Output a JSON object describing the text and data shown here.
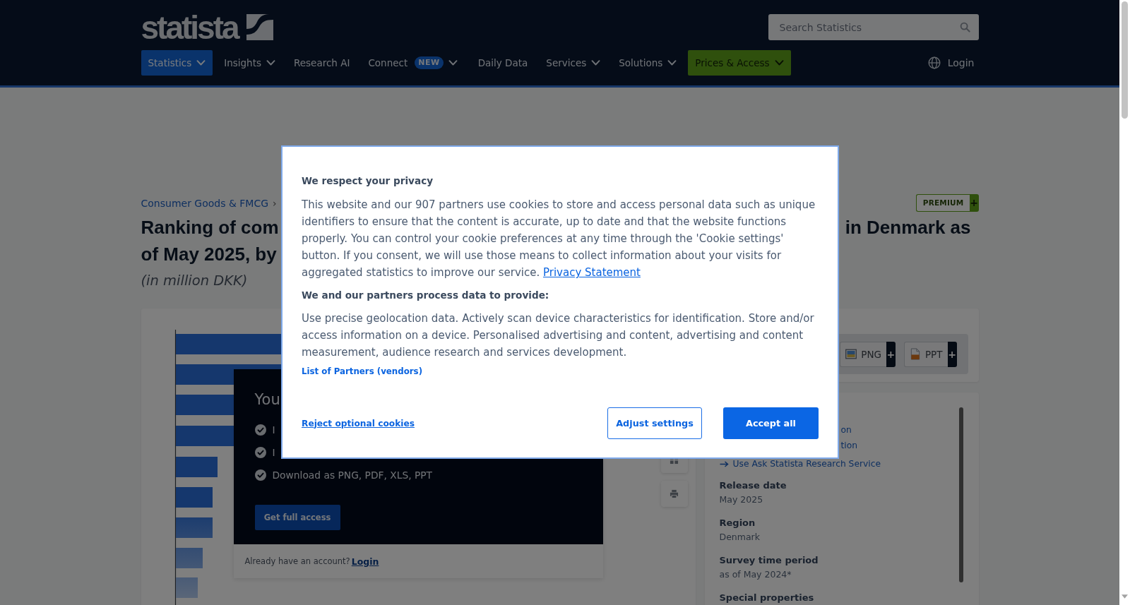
{
  "header": {
    "logo": {
      "text": "statista"
    },
    "search": {
      "placeholder": "Search Statistics"
    },
    "nav": [
      {
        "label": "Statistics",
        "kind": "menu",
        "selected": true
      },
      {
        "label": "Insights",
        "kind": "menu",
        "selected": false
      },
      {
        "label": "Research AI",
        "kind": "link",
        "selected": false
      },
      {
        "label": "Connect",
        "kind": "menu",
        "selected": false,
        "badge": "NEW"
      },
      {
        "label": "Daily Data",
        "kind": "link",
        "selected": false
      },
      {
        "label": "Services",
        "kind": "menu",
        "selected": false
      },
      {
        "label": "Solutions",
        "kind": "menu",
        "selected": false
      },
      {
        "label": "Prices & Access",
        "kind": "cta",
        "selected": false
      }
    ],
    "login": "Login"
  },
  "breadcrumb": {
    "items": [
      "Consumer Goods & FMCG"
    ],
    "separator": "›"
  },
  "premium_badge": {
    "label": "PREMIUM",
    "plus": "+"
  },
  "title": {
    "lines": [
      {
        "parts": [
          "Ranking of com",
          "in Denmark as"
        ]
      },
      {
        "parts": [
          "of May 2025, by"
        ]
      }
    ]
  },
  "subtitle": "(in million DKK)",
  "paywall": {
    "heading": "You",
    "features": [
      "I",
      "I",
      "Download as PNG, PDF, XLS, PPT"
    ],
    "button": "Get full access",
    "account_prompt": "Already have an account?",
    "login_link": "Login"
  },
  "downloads": [
    {
      "label": "PNG",
      "plus": "+",
      "kind": "image"
    },
    {
      "label": "PPT",
      "plus": "+",
      "kind": "slides"
    }
  ],
  "info_panel": {
    "links": [
      {
        "text": "on",
        "kind": "fragment"
      },
      {
        "text": "tion",
        "kind": "fragment"
      },
      {
        "text": "Use Ask Statista Research Service",
        "kind": "arrow"
      }
    ],
    "details": [
      {
        "label": "Release date",
        "value": "May 2025"
      },
      {
        "label": "Region",
        "value": "Denmark"
      },
      {
        "label": "Survey time period",
        "value": "as of May 2024*"
      },
      {
        "label": "Special properties"
      }
    ]
  },
  "cookie_dialog": {
    "title": "We respect your privacy",
    "body": "This website and our 907 partners use cookies to store and access personal data such as unique identifiers to ensure that the content is accurate, up to date and that the website functions properly. You can control your cookie preferences at any time through the 'Cookie settings' button. If you consent, we will use those means to collect information about your visits for aggregated statistics to improve our service.",
    "privacy_link": "Privacy Statement",
    "purposes_title": "We and our partners process data to provide:",
    "purposes": "Use precise geolocation data. Actively scan device characteristics for identification. Store and/or access information on a device. Personalised advertising and content, advertising and content measurement, audience research and services development.",
    "partners_link": "List of Partners (vendors)",
    "reject": "Reject optional cookies",
    "adjust": "Adjust settings",
    "accept": "Accept all"
  }
}
